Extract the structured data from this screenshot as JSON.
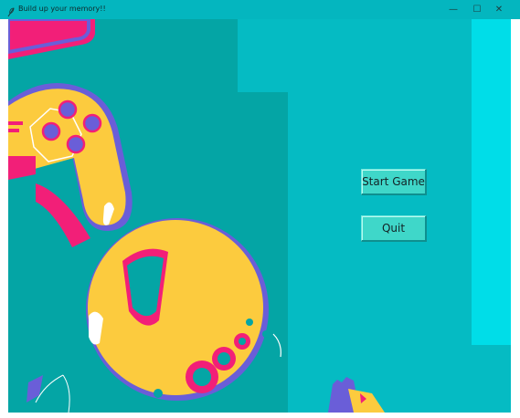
{
  "window": {
    "title": "Build up your memory!!",
    "icon": "feather-icon",
    "controls": {
      "minimize": "—",
      "maximize": "☐",
      "close": "✕"
    }
  },
  "menu": {
    "start_label": "Start Game",
    "quit_label": "Quit"
  },
  "colors": {
    "titlebar": "#04b6bf",
    "background": "#05bbc3",
    "panel_dark": "#04a5a5",
    "panel_light": "#00dde8",
    "button": "#3fd7c9",
    "accent_yellow": "#fccb3e",
    "accent_pink": "#f21f78",
    "accent_purple": "#6a5ed8"
  }
}
